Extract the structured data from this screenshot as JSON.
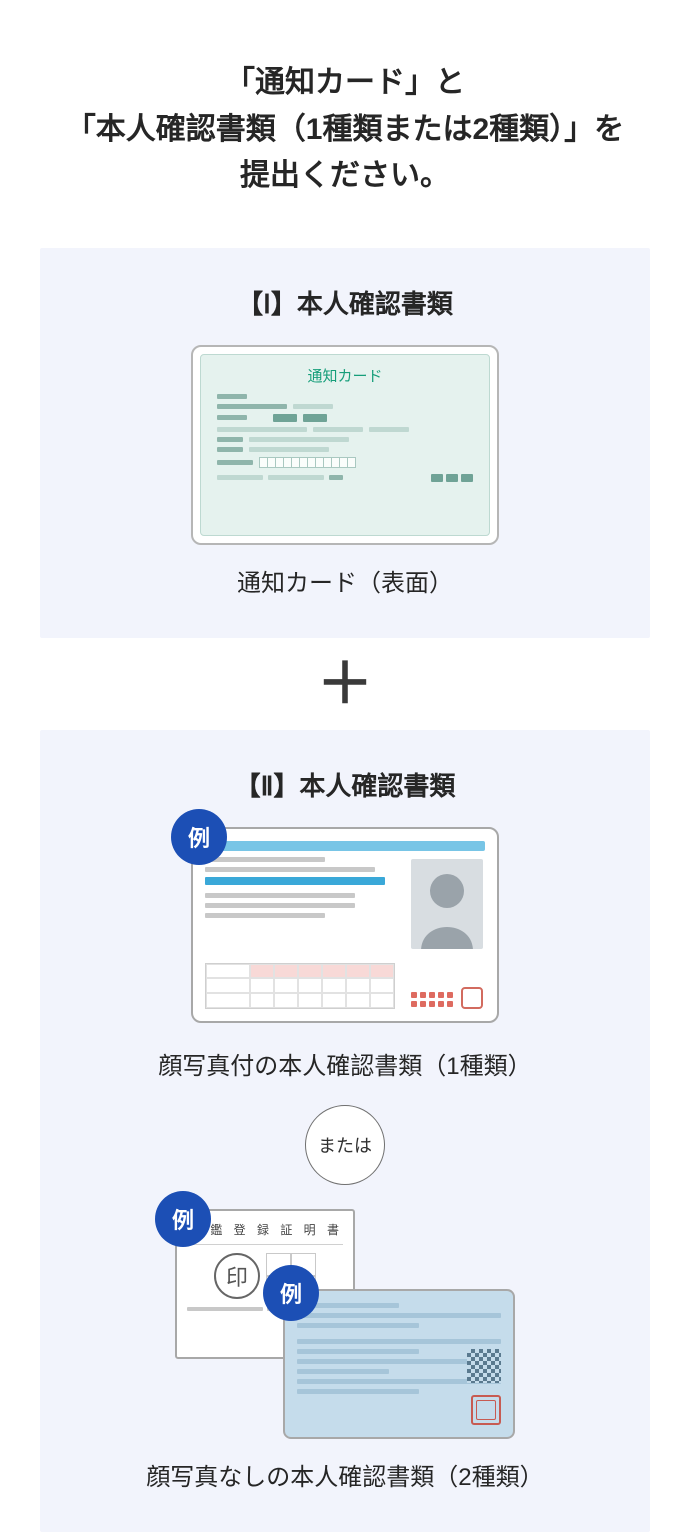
{
  "heading_line1": "「通知カード」と",
  "heading_line2": "「本人確認書類（1種類または2種類）」を",
  "heading_line3": "提出ください。",
  "plus_symbol": "＋",
  "section1": {
    "title": "【Ⅰ】本人確認書類",
    "card_label": "通知カード",
    "caption": "通知カード（表面）"
  },
  "section2": {
    "title": "【Ⅱ】本人確認書類",
    "example_badge": "例",
    "photo_caption": "顔写真付の本人確認書類（1種類）",
    "or_label": "または",
    "inkan_title": "印 鑑 登 録 証 明 書",
    "inkan_mark": "印",
    "nophoto_caption": "顔写真なしの本人確認書類（2種類）"
  }
}
